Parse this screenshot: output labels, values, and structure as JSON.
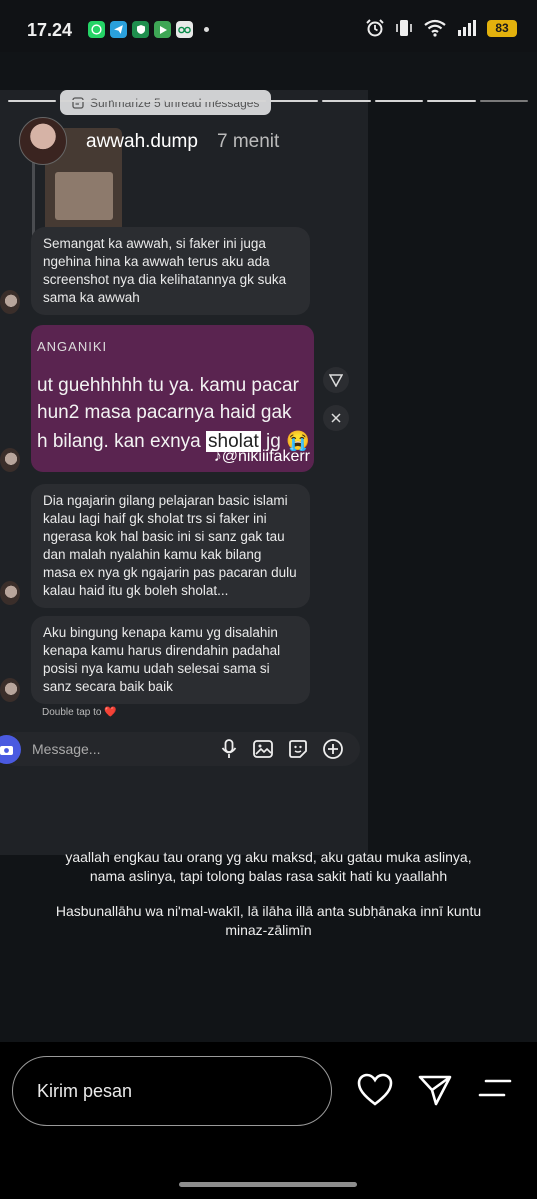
{
  "status_bar": {
    "time": "17.24",
    "battery": "83"
  },
  "story": {
    "summarize_label": "Summarize 5 unread messages",
    "username": "awwah.dump",
    "time_ago": "7 menit"
  },
  "chat": {
    "messages": [
      "Semangat ka awwah, si faker ini juga ngehina hina ka awwah terus aku ada screenshot nya dia kelihatannya gk suka sama ka awwah",
      "Dia ngajarin gilang pelajaran basic islami kalau lagi haif gk sholat trs si faker ini ngerasa kok hal basic ini si sanz gak tau dan malah nyalahin kamu kak bilang masa ex nya gk ngajarin pas pacaran dulu kalau haid itu gk boleh sholat...",
      "Aku bingung kenapa kamu yg disalahin kenapa kamu harus direndahin padahal posisi nya kamu udah selesai sama si sanz secara baik baik"
    ],
    "media": {
      "header": "ANGANIKI",
      "line1": "ut guehhhhh tu ya. kamu pacar",
      "line2": "hun2 masa pacarnya haid gak",
      "line3_pre": "h bilang. kan exnya ",
      "line3_hl": "sholat",
      "line3_post": " jg 😭",
      "watermark": "@nikiiifakerr"
    },
    "double_tap": "Double tap to ❤️",
    "message_placeholder": "Message..."
  },
  "caption": {
    "line1": "yaallah engkau tau orang yg aku maksd, aku gatau muka aslinya,",
    "line2": "nama aslinya, tapi tolong balas rasa sakit hati ku yaallahh",
    "line3": "Hasbunallāhu wa ni'mal-wakīl, lā ilāha illā anta subḥānaka innī kuntu",
    "line4": "minaz-zālimīn"
  },
  "bottom_bar": {
    "reply_placeholder": "Kirim pesan"
  }
}
